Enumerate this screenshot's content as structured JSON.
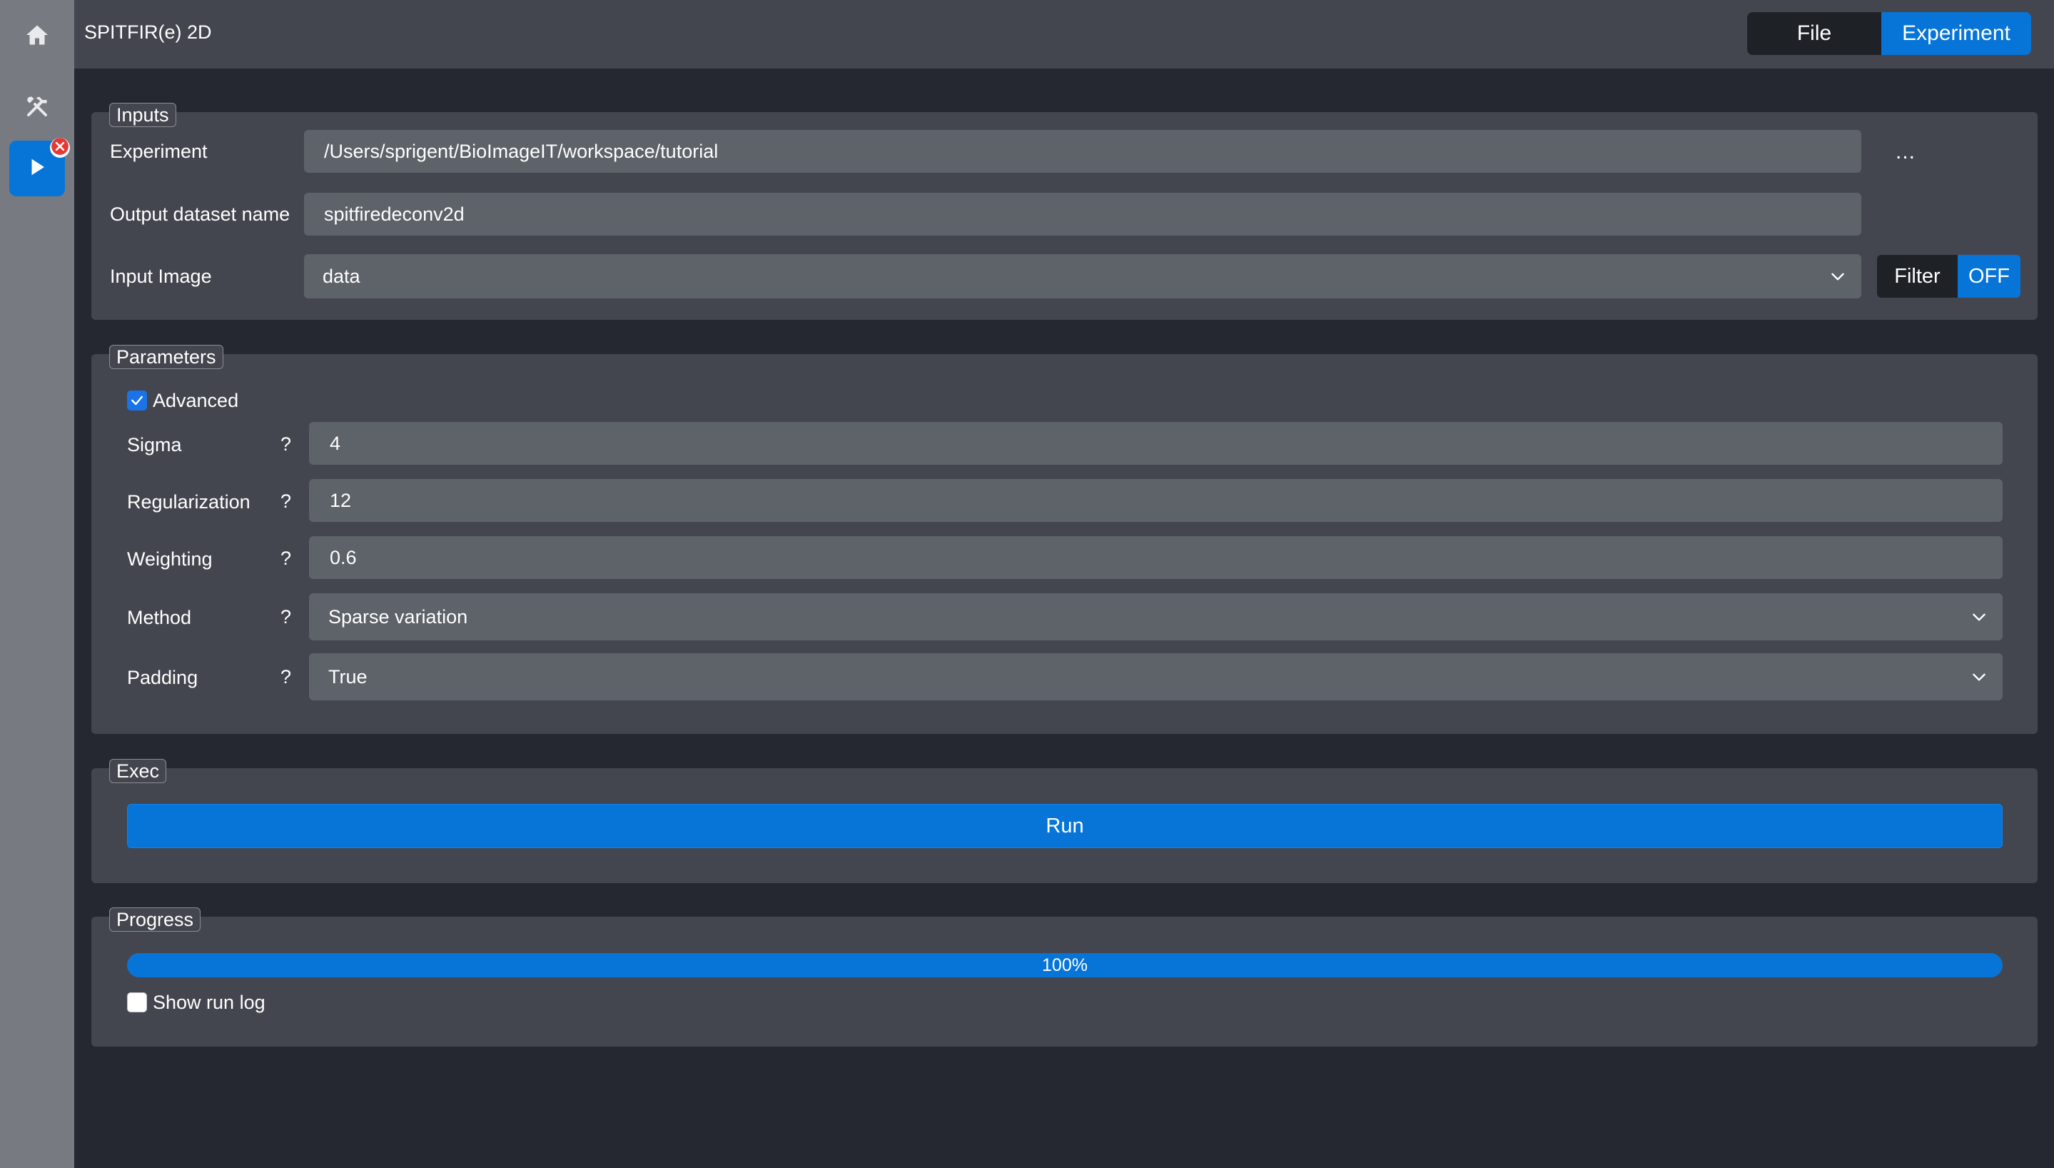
{
  "app": {
    "title": "SPITFIR(e) 2D"
  },
  "sidebar": {
    "items": [
      {
        "icon": "home-icon"
      },
      {
        "icon": "tools-icon"
      },
      {
        "icon": "play-icon",
        "active": true,
        "badge_icon": "close-icon"
      }
    ]
  },
  "header": {
    "tabs": [
      {
        "label": "File",
        "active": false
      },
      {
        "label": "Experiment",
        "active": true
      }
    ]
  },
  "inputs": {
    "legend": "Inputs",
    "experiment": {
      "label": "Experiment",
      "value": "/Users/sprigent/BioImageIT/workspace/tutorial",
      "browse_label": "..."
    },
    "output_dataset": {
      "label": "Output dataset name",
      "value": "spitfiredeconv2d"
    },
    "input_image": {
      "label": "Input Image",
      "value": "data"
    },
    "filter": {
      "label": "Filter",
      "state": "OFF"
    }
  },
  "parameters": {
    "legend": "Parameters",
    "advanced": {
      "label": "Advanced",
      "checked": true
    },
    "help_label": "?",
    "sigma": {
      "label": "Sigma",
      "value": "4"
    },
    "regularization": {
      "label": "Regularization",
      "value": "12"
    },
    "weighting": {
      "label": "Weighting",
      "value": "0.6"
    },
    "method": {
      "label": "Method",
      "value": "Sparse variation"
    },
    "padding": {
      "label": "Padding",
      "value": "True"
    }
  },
  "exec": {
    "legend": "Exec",
    "run_label": "Run"
  },
  "progress": {
    "legend": "Progress",
    "value": 100,
    "text": "100%",
    "show_log": {
      "label": "Show run log",
      "checked": false
    }
  },
  "colors": {
    "accent": "#0774d8",
    "background": "#252830",
    "panel": "#43464e",
    "field": "#5e6269",
    "sidebar": "#777b81",
    "badge": "#e53935"
  }
}
